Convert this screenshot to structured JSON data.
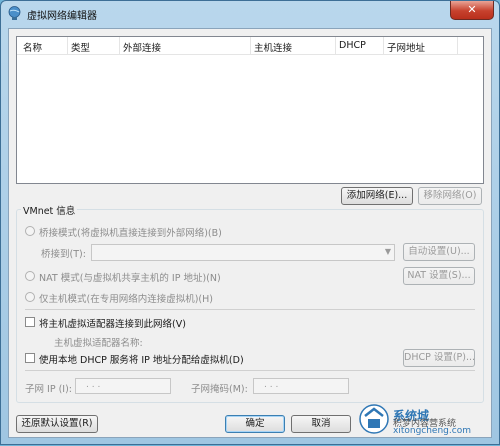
{
  "window": {
    "title": "虚拟网络编辑器",
    "close": "✕"
  },
  "list": {
    "columns": [
      "名称",
      "类型",
      "外部连接",
      "主机连接",
      "DHCP",
      "子网地址"
    ]
  },
  "buttons": {
    "add_network": "添加网络(E)...",
    "remove_network": "移除网络(O)",
    "auto_settings": "自动设置(U)...",
    "nat_settings": "NAT 设置(S)...",
    "dhcp_settings": "DHCP 设置(P)...",
    "restore_defaults": "还原默认设置(R)",
    "ok": "确定",
    "cancel": "取消"
  },
  "vmnet": {
    "group_title": "VMnet 信息",
    "bridged": "桥接模式(将虚拟机直接连接到外部网络)(B)",
    "bridged_to": "桥接到(T):",
    "nat": "NAT 模式(与虚拟机共享主机的 IP 地址)(N)",
    "host_only": "仅主机模式(在专用网络内连接虚拟机)(H)",
    "connect_adapter": "将主机虚拟适配器连接到此网络(V)",
    "adapter_name": "主机虚拟适配器名称:",
    "use_dhcp": "使用本地 DHCP 服务将 IP 地址分配给虚拟机(D)",
    "subnet_ip": "子网 IP (I):",
    "subnet_mask": "子网掩码(M):",
    "ip_dots": ".     .     ."
  },
  "watermark": {
    "line1": "系统城",
    "line2": "xitongcheng.com",
    "overlay": "积梦内容营系统"
  },
  "colors": {
    "accent": "#3c7fb1",
    "close": "#c7412d",
    "titlebar": "#b9d7ec"
  }
}
